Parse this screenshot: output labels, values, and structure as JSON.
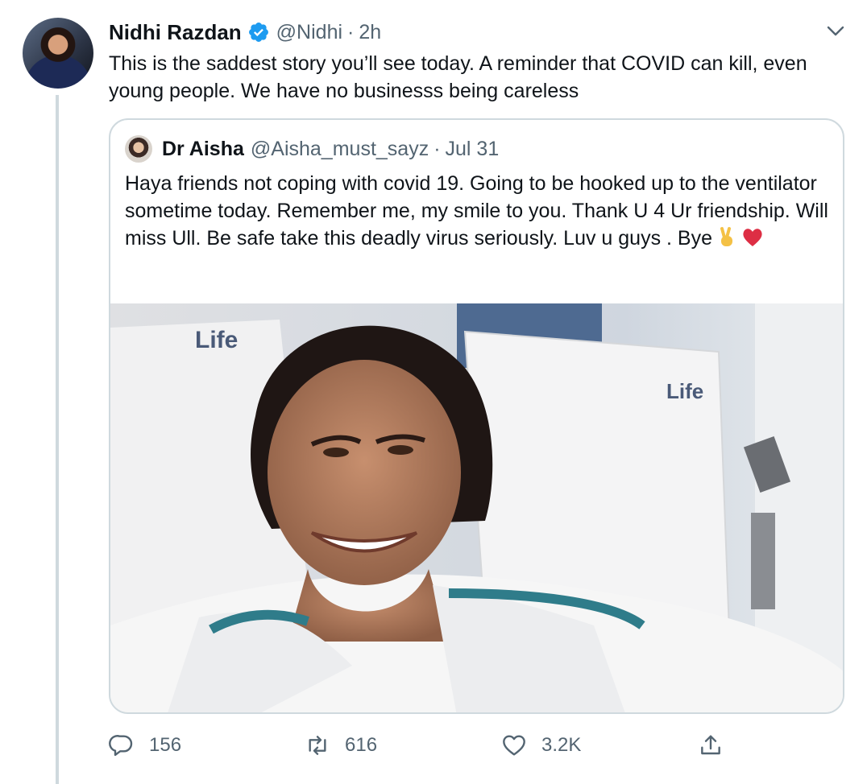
{
  "tweet": {
    "author_name": "Nidhi Razdan",
    "author_handle": "@Nidhi",
    "separator": "·",
    "time": "2h",
    "text": "This is the saddest story you’ll see today. A reminder that COVID can kill, even young people. We have no businesss being careless"
  },
  "quoted": {
    "author_name": "Dr Aisha",
    "author_handle": "@Aisha_must_sayz",
    "separator": "·",
    "time": "Jul 31",
    "text": "Haya friends not coping with covid 19. Going to be hooked up to the ventilator sometime today. Remember me, my smile to you.  Thank U 4 Ur friendship.  Will miss Ull. Be safe take this deadly virus seriously. Luv u guys . Bye",
    "emojis": [
      "victory-hand-icon",
      "red-heart-icon"
    ],
    "photo_pillow_text": "Life"
  },
  "actions": {
    "reply_count": "156",
    "retweet_count": "616",
    "like_count": "3.2K"
  },
  "colors": {
    "text": "#0f1419",
    "secondary": "#536471",
    "verified": "#1d9bf0",
    "border": "#cfd9de"
  }
}
